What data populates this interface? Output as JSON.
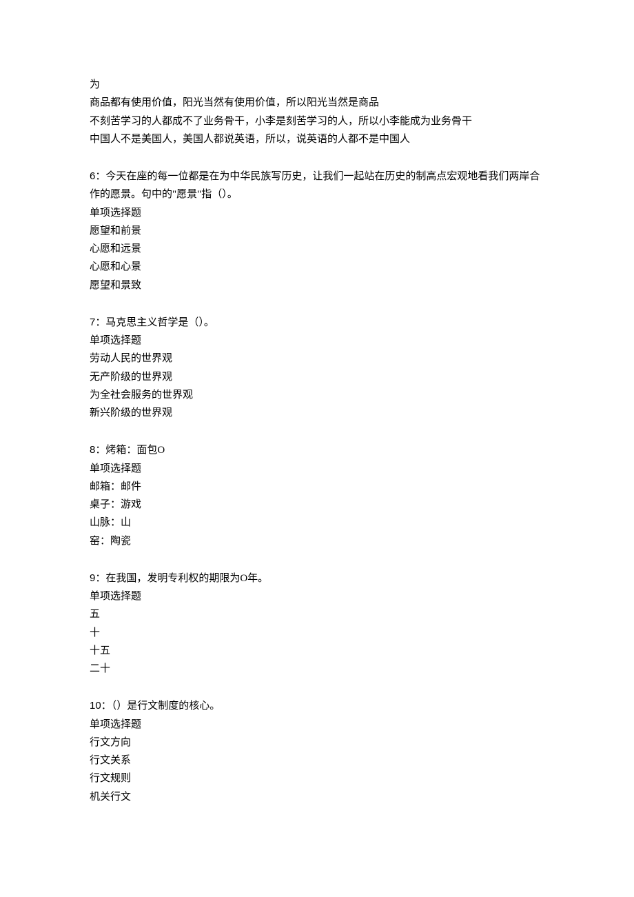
{
  "intro_lines": [
    "为",
    "商品都有使用价值，阳光当然有使用价值，所以阳光当然是商品",
    "不刻苦学习的人都成不了业务骨干，小李是刻苦学习的人，所以小李能成为业务骨干",
    "中国人不是美国人，美国人都说英语，所以，说英语的人都不是中国人"
  ],
  "questions": [
    {
      "number": "6：",
      "text_lines": [
        "今天在座的每一位都是在为中华民族写历史，让我们一起站在历史的制高点宏观地看我们两岸合作的愿景。句中的\"愿景\"指（）。"
      ],
      "type_label": "单项选择题",
      "choices": [
        "愿望和前景",
        "心愿和远景",
        "心愿和心景",
        "愿望和景致"
      ]
    },
    {
      "number": "7：",
      "text_lines": [
        "马克思主义哲学是（）。"
      ],
      "type_label": "单项选择题",
      "choices": [
        "劳动人民的世界观",
        "无产阶级的世界观",
        "为全社会服务的世界观",
        "新兴阶级的世界观"
      ]
    },
    {
      "number": "8：",
      "text_lines": [
        "烤箱：面包O"
      ],
      "type_label": "单项选择题",
      "choices": [
        "邮箱：邮件",
        "桌子：游戏",
        "山脉：山",
        "窑：陶瓷"
      ]
    },
    {
      "number": "9：",
      "text_lines": [
        "在我国，发明专利权的期限为O年。"
      ],
      "type_label": "单项选择题",
      "choices": [
        "五",
        "十",
        "十五",
        "二十"
      ]
    },
    {
      "number": "10：",
      "text_lines": [
        "（）是行文制度的核心。"
      ],
      "type_label": "单项选择题",
      "choices": [
        "行文方向",
        "行文关系",
        "行文规则",
        "机关行文"
      ]
    }
  ]
}
